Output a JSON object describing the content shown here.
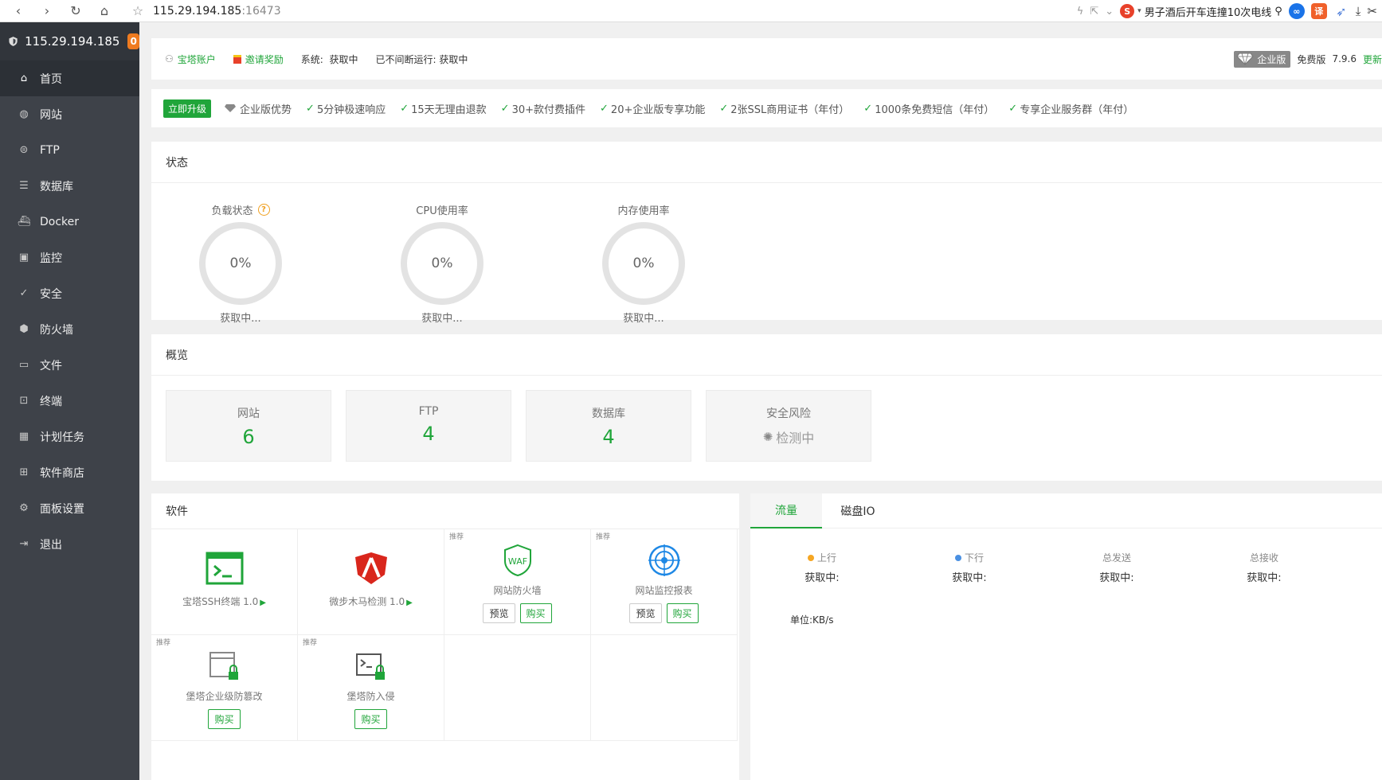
{
  "browser": {
    "url_host": "115.29.194.185",
    "url_port": ":16473",
    "search_text": "男子酒后开车连撞10次电线",
    "ext_translate": "译"
  },
  "sidebar": {
    "host": "115.29.194.185",
    "badge": "0",
    "items": [
      {
        "label": "首页",
        "icon": "home-icon"
      },
      {
        "label": "网站",
        "icon": "globe-icon"
      },
      {
        "label": "FTP",
        "icon": "ftp-icon"
      },
      {
        "label": "数据库",
        "icon": "database-icon"
      },
      {
        "label": "Docker",
        "icon": "docker-icon"
      },
      {
        "label": "监控",
        "icon": "monitor-icon"
      },
      {
        "label": "安全",
        "icon": "shield-check-icon"
      },
      {
        "label": "防火墙",
        "icon": "firewall-icon"
      },
      {
        "label": "文件",
        "icon": "folder-icon"
      },
      {
        "label": "终端",
        "icon": "terminal-icon"
      },
      {
        "label": "计划任务",
        "icon": "calendar-icon"
      },
      {
        "label": "软件商店",
        "icon": "grid-icon"
      },
      {
        "label": "面板设置",
        "icon": "gear-icon"
      },
      {
        "label": "退出",
        "icon": "logout-icon"
      }
    ]
  },
  "topbar": {
    "account": "宝塔账户",
    "invite": "邀请奖励",
    "system_label": "系统:",
    "system_value": "获取中",
    "uptime_label": "已不间断运行:",
    "uptime_value": "获取中",
    "enterprise": "企业版",
    "free_version": "免费版",
    "version": "7.9.6",
    "update": "更新"
  },
  "promo": {
    "upgrade": "立即升级",
    "title": "企业版优势",
    "features": [
      "5分钟极速响应",
      "15天无理由退款",
      "30+款付费插件",
      "20+企业版专享功能",
      "2张SSL商用证书（年付）",
      "1000条免费短信（年付）",
      "专享企业服务群（年付）"
    ]
  },
  "status": {
    "title": "状态",
    "gauges": [
      {
        "label": "负载状态",
        "value": "0%",
        "sub": "获取中..."
      },
      {
        "label": "CPU使用率",
        "value": "0%",
        "sub": "获取中..."
      },
      {
        "label": "内存使用率",
        "value": "0%",
        "sub": "获取中..."
      }
    ]
  },
  "overview": {
    "title": "概览",
    "boxes": [
      {
        "label": "网站",
        "value": "6"
      },
      {
        "label": "FTP",
        "value": "4"
      },
      {
        "label": "数据库",
        "value": "4"
      },
      {
        "label": "安全风险",
        "value": "检测中"
      }
    ]
  },
  "software": {
    "title": "软件",
    "rec_tag": "推荐",
    "items": [
      {
        "name": "宝塔SSH终端 1.0",
        "play": "▶"
      },
      {
        "name": "微步木马检测 1.0",
        "play": "▶"
      },
      {
        "name": "网站防火墙",
        "preview": "预览",
        "buy": "购买"
      },
      {
        "name": "网站监控报表",
        "preview": "预览",
        "buy": "购买"
      },
      {
        "name": "堡塔企业级防篡改",
        "buy": "购买"
      },
      {
        "name": "堡塔防入侵",
        "buy": "购买"
      }
    ],
    "waf_text": "WAF"
  },
  "traffic": {
    "tabs": [
      "流量",
      "磁盘IO"
    ],
    "stats": [
      {
        "label": "上行",
        "value": "获取中:"
      },
      {
        "label": "下行",
        "value": "获取中:"
      },
      {
        "label": "总发送",
        "value": "获取中:"
      },
      {
        "label": "总接收",
        "value": "获取中:"
      }
    ],
    "unit": "单位:KB/s"
  },
  "colors": {
    "accent": "#20a53a",
    "sidebar_bg": "#3e4249",
    "badge": "#ef7b20",
    "up_dot": "#f5a623",
    "down_dot": "#4a90e2"
  }
}
